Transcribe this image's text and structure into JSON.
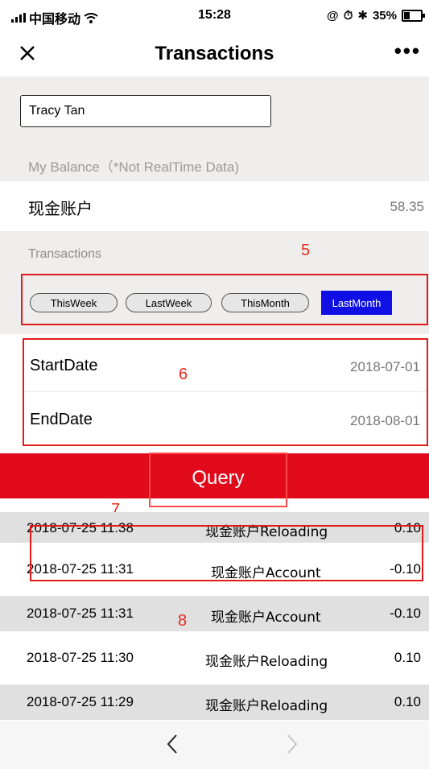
{
  "status_bar": {
    "carrier": "中国移动",
    "time": "15:28",
    "battery": "35%"
  },
  "header": {
    "title": "Transactions",
    "more": "•••"
  },
  "customer": {
    "name": "Tracy Tan"
  },
  "balance": {
    "label": "My Balance（*Not RealTime Data)",
    "account_name": "现金账户",
    "amount": "58.35"
  },
  "transactions": {
    "label": "Transactions",
    "periods": [
      "ThisWeek",
      "LastWeek",
      "ThisMonth",
      "LastMonth"
    ],
    "selected_period": "LastMonth",
    "start_label": "StartDate",
    "start_value": "2018-07-01",
    "end_label": "EndDate",
    "end_value": "2018-08-01",
    "query_label": "Query",
    "rows": [
      {
        "datetime": "2018-07-25 11:38",
        "name": "现金账户Reloading",
        "amount": "0.10"
      },
      {
        "datetime": "2018-07-25 11:31",
        "name": "现金账户Account",
        "amount": "-0.10"
      },
      {
        "datetime": "2018-07-25 11:31",
        "name": "现金账户Account",
        "amount": "-0.10"
      },
      {
        "datetime": "2018-07-25 11:30",
        "name": "现金账户Reloading",
        "amount": "0.10"
      },
      {
        "datetime": "2018-07-25 11:29",
        "name": "现金账户Reloading",
        "amount": "0.10"
      }
    ]
  },
  "annotations": [
    "5",
    "6",
    "7",
    "8"
  ],
  "colors": {
    "highlight": "#e31a1a",
    "query_bar": "#e10a1a",
    "selected_pill": "#1010e6"
  },
  "nav": {
    "back_icon": "chevron-left-icon",
    "forward_icon": "chevron-right-icon"
  }
}
